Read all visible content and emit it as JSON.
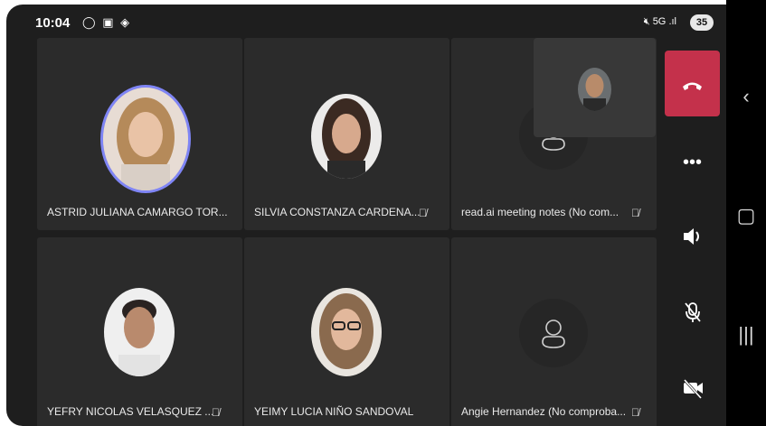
{
  "status_bar": {
    "time": "10:04",
    "battery": "35"
  },
  "participants": [
    {
      "name": "ASTRID JULIANA CAMARGO TOR...",
      "muted": false,
      "avatar": "photo"
    },
    {
      "name": "SILVIA CONSTANZA CARDENA...",
      "muted": true,
      "avatar": "photo"
    },
    {
      "name": "read.ai meeting notes (No com...",
      "muted": true,
      "avatar": "person-icon"
    },
    {
      "name": "YEFRY NICOLAS VELASQUEZ ...",
      "muted": true,
      "avatar": "photo"
    },
    {
      "name": "YEIMY LUCIA NIÑO SANDOVAL",
      "muted": false,
      "avatar": "photo"
    },
    {
      "name": "Angie Hernandez (No comproba...",
      "muted": true,
      "avatar": "person-icon"
    }
  ],
  "controls": {
    "end_call_color": "#c4314b",
    "items": [
      "hang-up-icon",
      "more-icon",
      "speaker-icon",
      "mic-off-icon",
      "video-off-icon"
    ]
  },
  "colors": {
    "background": "#1e1e1e",
    "tile": "#2b2b2b",
    "speaking_ring": "#7f85f5"
  }
}
